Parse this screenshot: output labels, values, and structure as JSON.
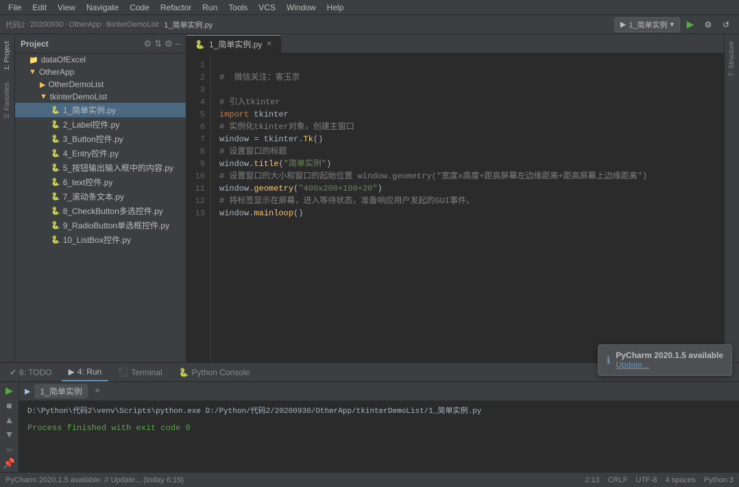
{
  "menubar": {
    "items": [
      "File",
      "Edit",
      "View",
      "Navigate",
      "Code",
      "Refactor",
      "Run",
      "Tools",
      "VCS",
      "Window",
      "Help"
    ]
  },
  "toolbar": {
    "breadcrumbs": [
      "代码2",
      "20200930",
      "OtherApp",
      "tkinterDemoList",
      "1_简单实例.py"
    ],
    "run_config": "1_简单实例",
    "run_btn_title": "Run",
    "debug_btn_title": "Debug",
    "settings_btn_title": "Settings",
    "reload_btn_title": "Reload"
  },
  "project_panel": {
    "title": "Project",
    "items": [
      {
        "label": "dataOfExcel",
        "type": "folder",
        "indent": 0
      },
      {
        "label": "OtherApp",
        "type": "folder",
        "indent": 0
      },
      {
        "label": "OtherDemoList",
        "type": "folder",
        "indent": 1
      },
      {
        "label": "tkinterDemoList",
        "type": "folder",
        "indent": 1
      },
      {
        "label": "1_简单实例.py",
        "type": "py",
        "indent": 2,
        "selected": true
      },
      {
        "label": "2_Label控件.py",
        "type": "py",
        "indent": 2
      },
      {
        "label": "3_Button控件.py",
        "type": "py",
        "indent": 2
      },
      {
        "label": "4_Entry控件.py",
        "type": "py",
        "indent": 2
      },
      {
        "label": "5_按钮输出输入框中的内容.py",
        "type": "py",
        "indent": 2
      },
      {
        "label": "6_text控件.py",
        "type": "py",
        "indent": 2
      },
      {
        "label": "7_滚动条文本.py",
        "type": "py",
        "indent": 2
      },
      {
        "label": "8_CheckButton多选控件.py",
        "type": "py",
        "indent": 2
      },
      {
        "label": "9_RadioButton单选框控件.py",
        "type": "py",
        "indent": 2
      },
      {
        "label": "10_ListBox控件.py",
        "type": "py",
        "indent": 2
      }
    ]
  },
  "editor": {
    "tab_label": "1_简单实例.py",
    "lines": [
      {
        "num": 1,
        "content": "",
        "parts": []
      },
      {
        "num": 2,
        "content": "#  微信关注：客玉京",
        "comment": true
      },
      {
        "num": 3,
        "content": "",
        "parts": []
      },
      {
        "num": 4,
        "content": "# 引入tkinter",
        "comment": true
      },
      {
        "num": 5,
        "content": "import tkinter",
        "keyword": "import",
        "rest": " tkinter"
      },
      {
        "num": 6,
        "content": "# 实例化tkinter对象，创建主窗口",
        "comment": true
      },
      {
        "num": 7,
        "content": "window = tkinter.Tk()",
        "parts": [
          {
            "t": "normal",
            "v": "window = tkinter."
          },
          {
            "t": "func",
            "v": "Tk"
          },
          {
            "t": "normal",
            "v": "()"
          }
        ]
      },
      {
        "num": 8,
        "content": "# 设置窗口的标题",
        "comment": true
      },
      {
        "num": 9,
        "content": "window.title(\"简单实例\")",
        "parts": [
          {
            "t": "normal",
            "v": "window."
          },
          {
            "t": "func",
            "v": "title"
          },
          {
            "t": "normal",
            "v": "("
          },
          {
            "t": "string",
            "v": "\"简单实例\""
          },
          {
            "t": "normal",
            "v": ")"
          }
        ]
      },
      {
        "num": 10,
        "content": "# 设置窗口的大小和窗口的起始位置 window.geometry(\"宽度x高度+距高屏幕左边缘距离+距高屏幕上边缘距离\")",
        "comment": true
      },
      {
        "num": 11,
        "content": "window.geometry(\"400x200+100+20\")",
        "parts": [
          {
            "t": "normal",
            "v": "window."
          },
          {
            "t": "func",
            "v": "geometry"
          },
          {
            "t": "normal",
            "v": "("
          },
          {
            "t": "string",
            "v": "\"400x200+100+20\""
          },
          {
            "t": "normal",
            "v": ")"
          }
        ]
      },
      {
        "num": 12,
        "content": "# 将标签显示在屏幕，进入等待状态，准备响应用户发起的GUI事件。",
        "comment": true
      },
      {
        "num": 13,
        "content": "window.mainloop()",
        "parts": [
          {
            "t": "normal",
            "v": "window."
          },
          {
            "t": "func",
            "v": "mainloop"
          },
          {
            "t": "normal",
            "v": "()"
          }
        ]
      }
    ]
  },
  "run_panel": {
    "title": "1_简单实例",
    "run_path": "D:\\Python\\代码2\\venv\\Scripts\\python.exe D:/Python/代码2/20200930/OtherApp/tkinterDemoList/1_简单实例.py",
    "exit_msg": "Process finished with exit code 0"
  },
  "bottom_tabs": [
    {
      "label": "6: TODO",
      "icon": "todo"
    },
    {
      "label": "4: Run",
      "icon": "run",
      "active": true
    },
    {
      "label": "Terminal",
      "icon": "terminal"
    },
    {
      "label": "Python Console",
      "icon": "python"
    }
  ],
  "side_tabs": [
    {
      "label": "1: Project",
      "active": true
    },
    {
      "label": "2: Favorites"
    }
  ],
  "side_tabs_right": [
    {
      "label": "7: Structure"
    }
  ],
  "notification": {
    "title": "PyCharm 2020.1.5 available",
    "link": "Update..."
  },
  "statusbar": {
    "position": "2:13",
    "encoding": "CRLF",
    "charset": "UTF-8",
    "indent": "4 spaces",
    "python": "Python 3"
  }
}
